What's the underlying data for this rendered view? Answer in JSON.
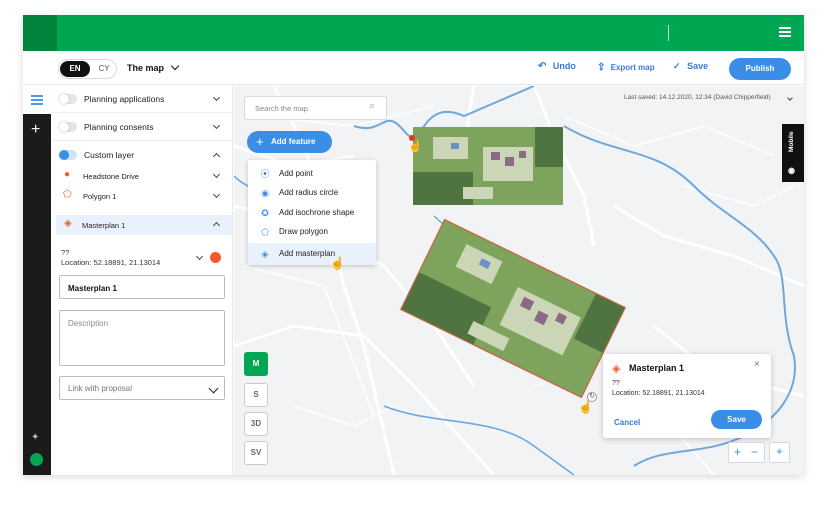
{
  "header": {
    "lang_en": "EN",
    "lang_cy": "CY",
    "map_title": "The map",
    "undo": "Undo",
    "export": "Export map",
    "save": "Save",
    "publish": "Publish"
  },
  "sidebar": {
    "layers": [
      {
        "label": "Planning applications",
        "enabled": false
      },
      {
        "label": "Planning consents",
        "enabled": false
      },
      {
        "label": "Custom layer",
        "enabled": true
      }
    ],
    "sub_items": [
      "Headstone Drive",
      "Polygon 1"
    ],
    "selected": "Masterplan 1",
    "info_q": "??",
    "info_location": "Location:  52.18891, 21.13014",
    "name_value": "Masterplan 1",
    "description_placeholder": "Description",
    "link_placeholder": "Link with proposal",
    "accent_color": "#f05a28"
  },
  "map": {
    "search_placeholder": "Search the map",
    "last_saved": "Last saved:  14.12.2020, 12:34 (David Chipperfield)",
    "add_feature": "Add feature",
    "menu": [
      "Add point",
      "Add radius circle",
      "Add isochrone shape",
      "Draw polygon",
      "Add masterplan"
    ],
    "view_buttons": [
      "M",
      "S",
      "3D",
      "SV"
    ],
    "active_view": "M",
    "mobile": "Mobile"
  },
  "popup": {
    "title": "Masterplan 1",
    "q": "??",
    "location": "Location:  52.18891, 21.13014",
    "cancel": "Cancel",
    "save": "Save"
  },
  "colors": {
    "brand": "#00a651",
    "primary": "#3a8ee6",
    "river": "#6fa8dc"
  }
}
